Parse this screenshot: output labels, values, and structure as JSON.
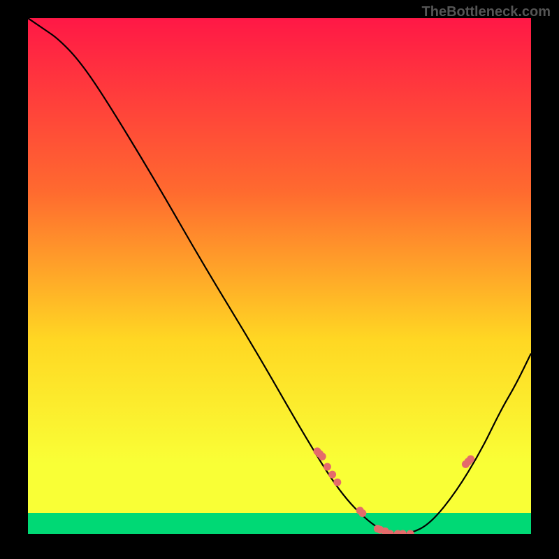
{
  "watermark": "TheBottleneck.com",
  "chart_data": {
    "type": "line",
    "title": "",
    "xlabel": "",
    "ylabel": "",
    "xlim": [
      0,
      1
    ],
    "ylim": [
      0,
      1
    ],
    "grid": false,
    "legend": false,
    "background_gradient": {
      "top_color": "#ff1846",
      "upper_mid_color": "#ff6a2f",
      "mid_color": "#ffd723",
      "lower_mid_color": "#f9ff36",
      "bottom_band_color": "#00d975"
    },
    "series": [
      {
        "name": "curve",
        "type": "line",
        "color": "#000000",
        "x": [
          0.0,
          0.03,
          0.06,
          0.1,
          0.15,
          0.25,
          0.35,
          0.45,
          0.55,
          0.62,
          0.68,
          0.72,
          0.76,
          0.8,
          0.85,
          0.9,
          0.94,
          0.97,
          1.0
        ],
        "y": [
          1.0,
          0.98,
          0.96,
          0.92,
          0.85,
          0.69,
          0.52,
          0.36,
          0.19,
          0.08,
          0.02,
          0.0,
          0.0,
          0.02,
          0.08,
          0.16,
          0.24,
          0.29,
          0.35
        ]
      },
      {
        "name": "points",
        "type": "scatter",
        "color": "#e46b6b",
        "x": [
          0.575,
          0.58,
          0.585,
          0.595,
          0.605,
          0.615,
          0.66,
          0.665,
          0.695,
          0.7,
          0.71,
          0.72,
          0.735,
          0.745,
          0.76,
          0.87,
          0.875,
          0.88
        ],
        "y": [
          0.16,
          0.155,
          0.15,
          0.13,
          0.115,
          0.1,
          0.045,
          0.04,
          0.01,
          0.008,
          0.005,
          0.0,
          0.0,
          0.0,
          0.0,
          0.135,
          0.14,
          0.145
        ]
      }
    ]
  }
}
